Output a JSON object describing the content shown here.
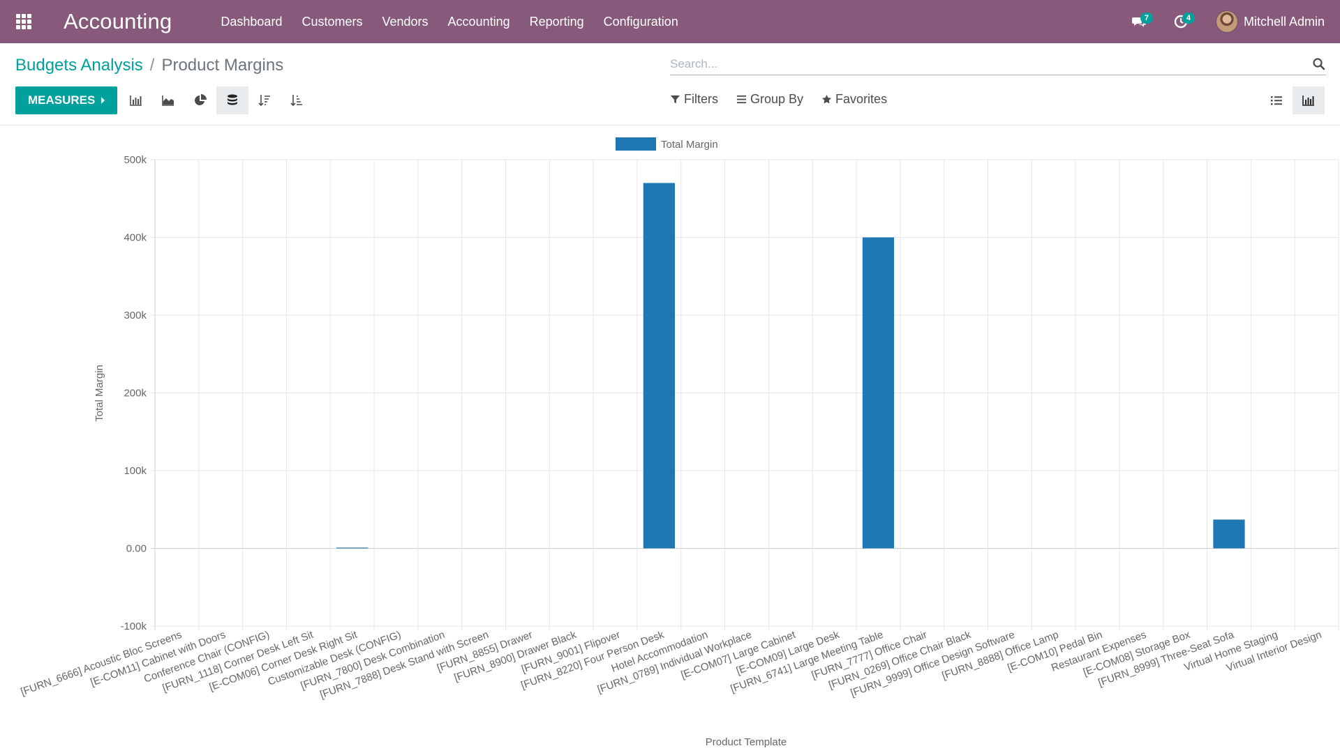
{
  "navbar": {
    "brand": "Accounting",
    "menu": [
      {
        "label": "Dashboard"
      },
      {
        "label": "Customers"
      },
      {
        "label": "Vendors"
      },
      {
        "label": "Accounting"
      },
      {
        "label": "Reporting"
      },
      {
        "label": "Configuration"
      }
    ],
    "messages_count": "7",
    "activities_count": "4",
    "user_name": "Mitchell Admin",
    "bg_color": "#875a7b"
  },
  "breadcrumb": {
    "parent": "Budgets Analysis",
    "separator": "/",
    "current": "Product Margins"
  },
  "search": {
    "placeholder": "Search..."
  },
  "toolbar": {
    "measures_label": "MEASURES",
    "accent_color": "#00a09d",
    "icons": [
      "bar-chart-icon",
      "line-chart-icon",
      "pie-chart-icon",
      "stacked-icon",
      "sort-descending-icon",
      "sort-ascending-icon"
    ]
  },
  "filters": {
    "filters_label": "Filters",
    "group_by_label": "Group By",
    "favorites_label": "Favorites"
  },
  "chart_data": {
    "type": "bar",
    "legend_label": "Total Margin",
    "legend_position": "top-center",
    "ylabel": "Total Margin",
    "xlabel": "Product Template",
    "ylim": [
      -100000,
      500000
    ],
    "yticks": [
      {
        "value": 500000,
        "label": "500k"
      },
      {
        "value": 400000,
        "label": "400k"
      },
      {
        "value": 300000,
        "label": "300k"
      },
      {
        "value": 200000,
        "label": "200k"
      },
      {
        "value": 100000,
        "label": "100k"
      },
      {
        "value": 0,
        "label": "0.00"
      },
      {
        "value": -100000,
        "label": "-100k"
      }
    ],
    "grid": true,
    "bar_color": "#1f77b4",
    "categories": [
      "[FURN_6666] Acoustic Bloc Screens",
      "[E-COM11] Cabinet with Doors",
      "Conference Chair (CONFIG)",
      "[FURN_1118] Corner Desk Left Sit",
      "[E-COM06] Corner Desk Right Sit",
      "Customizable Desk (CONFIG)",
      "[FURN_7800] Desk Combination",
      "[FURN_7888] Desk Stand with Screen",
      "[FURN_8855] Drawer",
      "[FURN_8900] Drawer Black",
      "[FURN_9001] Flipover",
      "[FURN_8220] Four Person Desk",
      "Hotel Accommodation",
      "[FURN_0789] Individual Workplace",
      "[E-COM07] Large Cabinet",
      "[E-COM09] Large Desk",
      "[FURN_6741] Large Meeting Table",
      "[FURN_7777] Office Chair",
      "[FURN_0269] Office Chair Black",
      "[FURN_9999] Office Design Software",
      "[FURN_8888] Office Lamp",
      "[E-COM10] Pedal Bin",
      "Restaurant Expenses",
      "[E-COM08] Storage Box",
      "[FURN_8999] Three-Seat Sofa",
      "Virtual Home Staging",
      "Virtual Interior Design"
    ],
    "values": [
      0,
      0,
      0,
      0,
      1000,
      0,
      0,
      0,
      0,
      0,
      0,
      470000,
      0,
      0,
      0,
      0,
      400000,
      0,
      0,
      0,
      0,
      0,
      0,
      0,
      37000,
      0,
      0
    ]
  }
}
